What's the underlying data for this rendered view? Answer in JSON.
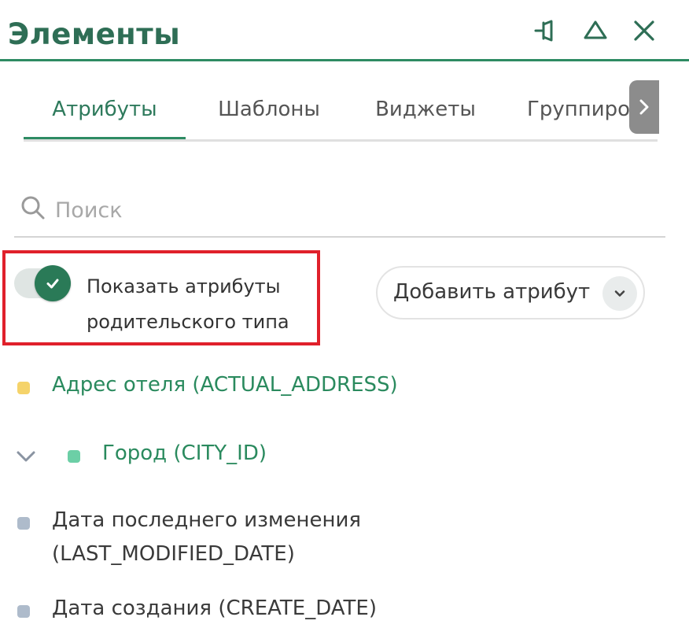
{
  "panel": {
    "title": "Элементы",
    "accent_color": "#2e8b63"
  },
  "header_icons": [
    {
      "name": "pin-icon"
    },
    {
      "name": "collapse-icon"
    },
    {
      "name": "close-icon"
    }
  ],
  "tabs": [
    {
      "label": "Атрибуты",
      "active": true
    },
    {
      "label": "Шаблоны",
      "active": false
    },
    {
      "label": "Виджеты",
      "active": false
    },
    {
      "label": "Группировки",
      "active": false
    }
  ],
  "search": {
    "placeholder": "Поиск",
    "value": ""
  },
  "toggle": {
    "label": "Показать атрибуты родительского типа",
    "checked": true
  },
  "add_attribute": {
    "label": "Добавить атрибут"
  },
  "attributes": [
    {
      "label": "Адрес отеля (ACTUAL_ADDRESS)",
      "color": "#f5d36a",
      "style": "green",
      "expandable": false
    },
    {
      "label": "Город (CITY_ID)",
      "color": "#6ccfa6",
      "style": "green",
      "expandable": true,
      "expanded": false
    },
    {
      "label": "Дата последнего изменения",
      "label_line2": "(LAST_MODIFIED_DATE)",
      "color": "#aebbcb",
      "style": "dark",
      "expandable": false
    },
    {
      "label": "Дата создания (CREATE_DATE)",
      "color": "#aebbcb",
      "style": "dark",
      "expandable": false
    }
  ]
}
